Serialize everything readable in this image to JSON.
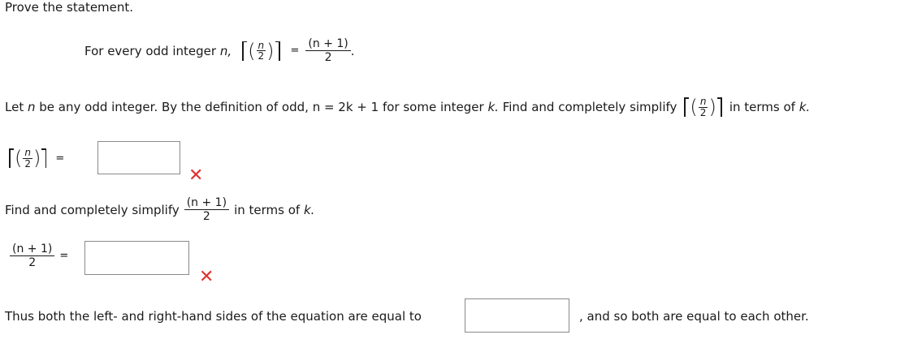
{
  "prompt": "Prove the statement.",
  "statement": {
    "prefix": "For every odd integer",
    "var_n": "n,",
    "lhs_num": "n",
    "lhs_den": "2",
    "equals": "=",
    "rhs_num": "(n + 1)",
    "rhs_den": "2",
    "period": "."
  },
  "instruction": {
    "text_1": "Let",
    "var_n": "n",
    "text_2": "be any odd integer. By the definition of odd,",
    "eq": "n = 2k + 1",
    "text_3": "for some integer",
    "var_k": "k.",
    "text_4": "Find and completely simplify",
    "lhs_num": "n",
    "lhs_den": "2",
    "text_5": "in terms of",
    "var_k2": "k."
  },
  "part1": {
    "lhs_num": "n",
    "lhs_den": "2",
    "equals": "=",
    "answer_value": "",
    "status_mark": "✕"
  },
  "part2": {
    "label": "Find and completely simplify",
    "frac_num": "(n + 1)",
    "frac_den": "2",
    "suffix": "in terms of",
    "var_k": "k.",
    "lhs_num": "(n + 1)",
    "lhs_den": "2",
    "equals": "=",
    "answer_value": "",
    "status_mark": "✕"
  },
  "conclusion": {
    "text_before": "Thus both the left- and right-hand sides of the equation are equal to",
    "answer_value": "",
    "text_after": ", and so both are equal to each other."
  },
  "colors": {
    "wrong_mark": "#e0322e",
    "box_border": "#8a8a8a"
  }
}
